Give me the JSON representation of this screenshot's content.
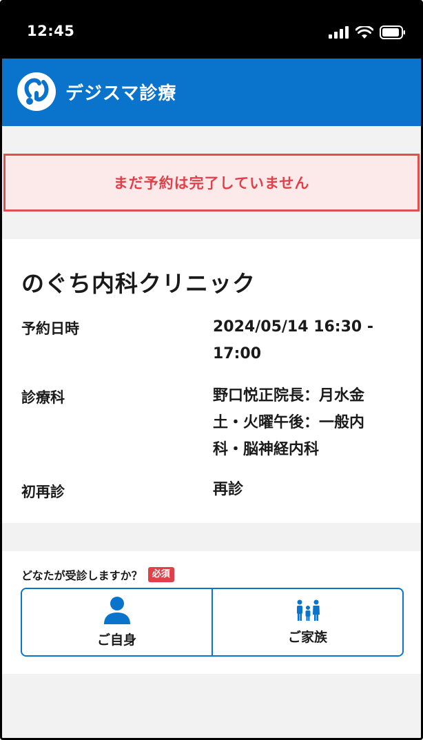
{
  "status_bar": {
    "time": "12:45",
    "icons": [
      "signal-icon",
      "wifi-icon",
      "battery-icon"
    ]
  },
  "app": {
    "title": "デジスマ診療",
    "brand_color": "#0a73cc",
    "logo_icon": "stethoscope-logo-icon"
  },
  "alert": {
    "message": "まだ予約は完了していません",
    "color": "#e0404a",
    "background": "#fce9ea"
  },
  "reservation": {
    "clinic_name": "のぐち内科クリニック",
    "rows": [
      {
        "label": "予約日時",
        "value_lines": [
          "2024/05/14 16:30 -",
          "17:00"
        ]
      },
      {
        "label": "診療科",
        "value_lines": [
          "野口悦正院長：月水金",
          "土・火曜午後：一般内",
          "科・脳神経内科"
        ]
      },
      {
        "label": "初再診",
        "value_lines": [
          "再診"
        ]
      }
    ]
  },
  "patient_question": {
    "question": "どなたが受診しますか？",
    "required_badge": "必須",
    "options": [
      {
        "label": "ご自身",
        "icon": "person-icon"
      },
      {
        "label": "ご家族",
        "icon": "family-icon"
      }
    ]
  }
}
